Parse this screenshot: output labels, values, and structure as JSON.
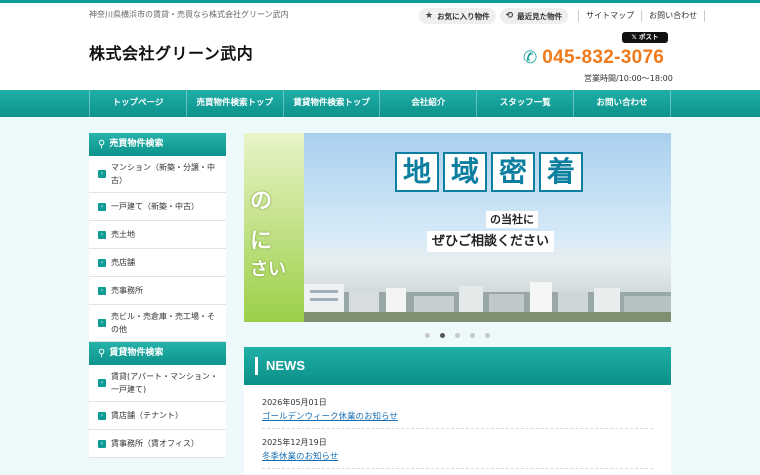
{
  "header": {
    "tagline": "神奈川県横浜市の賃貸・売買なら株式会社グリーン武内",
    "favorites_label": "お気に入り物件",
    "recent_label": "最近見た物件",
    "sitemap_label": "サイトマップ",
    "contact_label": "お問い合わせ",
    "logo_text": "株式会社グリーン武内",
    "x_post_label": "ポスト",
    "phone": "045-832-3076",
    "hours": "営業時間/10:00～18:00"
  },
  "nav": [
    {
      "label": "トップページ"
    },
    {
      "label": "売買物件検索トップ"
    },
    {
      "label": "賃貸物件検索トップ"
    },
    {
      "label": "会社紹介"
    },
    {
      "label": "スタッフ一覧"
    },
    {
      "label": "お問い合わせ"
    }
  ],
  "sidebar": {
    "sale_heading": "売買物件検索",
    "sale_items": [
      {
        "label": "マンション（新築・分譲・中古）"
      },
      {
        "label": "一戸建て（新築・中古）"
      },
      {
        "label": "売土地"
      },
      {
        "label": "売店舗"
      },
      {
        "label": "売事務所"
      },
      {
        "label": "売ビル・売倉庫・売工場・その他"
      }
    ],
    "rent_heading": "賃貸物件検索",
    "rent_items": [
      {
        "label": "賃貸(アパート・マンション・一戸建て)"
      },
      {
        "label": "賃店舗（テナント）"
      },
      {
        "label": "賃事務所（賃オフィス）"
      }
    ]
  },
  "slider": {
    "left_chars": [
      "の",
      "に",
      "さい"
    ],
    "kanji": [
      "地",
      "域",
      "密",
      "着"
    ],
    "subtitle1": "の当社に",
    "subtitle2": "ぜひご相談ください",
    "dot_count": 5,
    "active_dot": 2
  },
  "news": {
    "heading": "NEWS",
    "items": [
      {
        "date": "2026年05月01日",
        "title": "ゴールデンウィーク休業のお知らせ"
      },
      {
        "date": "2025年12月19日",
        "title": "冬季休業のお知らせ"
      }
    ]
  },
  "colors": {
    "accent": "#0d9c95",
    "phone": "#f07a1a",
    "link": "#1a6fb3"
  }
}
